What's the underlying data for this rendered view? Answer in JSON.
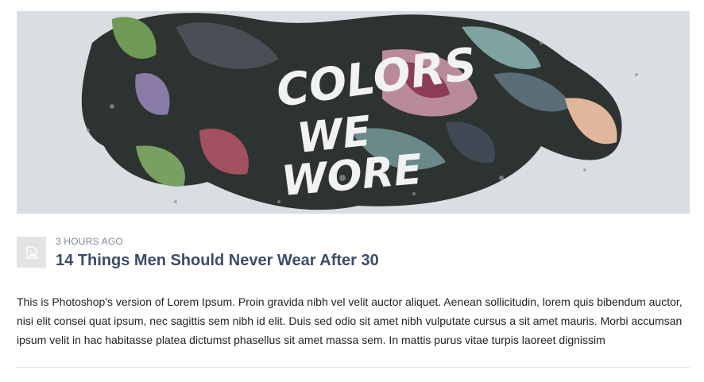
{
  "article": {
    "hero_text_lines": [
      "COLORS",
      "WE",
      "WORE"
    ],
    "timestamp": "3 HOURS AGO",
    "title": "14 Things Men Should Never Wear After 30",
    "body": "This is Photoshop's version of Lorem Ipsum. Proin gravida nibh vel velit auctor aliquet. Aenean sollicitudin, lorem quis bibendum auctor, nisi elit consei quat ipsum, nec sagittis sem nibh id elit. Duis sed odio sit amet nibh vulputate cursus a sit amet mauris. Morbi accumsan ipsum velit in hac habitasse platea dictumst phasellus sit amet massa sem. In mattis purus vitae turpis laoreet dignissim"
  },
  "icons": {
    "thumbnail": "image-placeholder-icon"
  },
  "colors": {
    "title": "#3b4d68",
    "timestamp": "#7c8794",
    "hero_background": "#d9dee2",
    "thumbnail_background": "#e3e3e3",
    "divider": "#e2e2e2"
  }
}
